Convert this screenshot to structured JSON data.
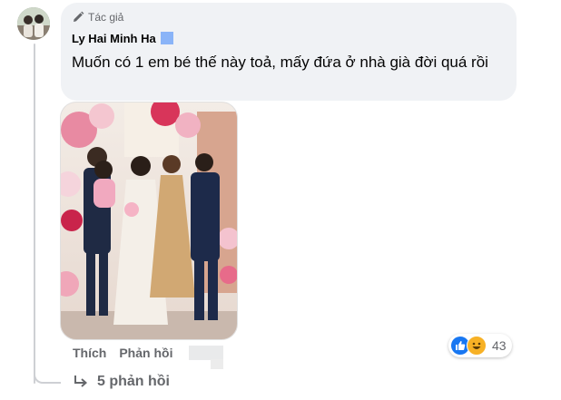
{
  "comment": {
    "badge_label": "Tác giả",
    "author": "Ly Hai Minh Ha",
    "text": "Muốn có 1 em bé thế này toả, mấy đứa ở nhà già đời quá rồi"
  },
  "actions": {
    "like": "Thích",
    "reply": "Phản hồi"
  },
  "reactions": {
    "count": "43",
    "icons": [
      "like-icon",
      "haha-icon"
    ]
  },
  "replies": {
    "label": "5 phản hồi"
  },
  "colors": {
    "bubble": "#f0f2f5",
    "secondary_text": "#65676b",
    "like_blue": "#1877f2",
    "haha_yellow": "#f7b125",
    "thread_line": "#ced0d4"
  }
}
